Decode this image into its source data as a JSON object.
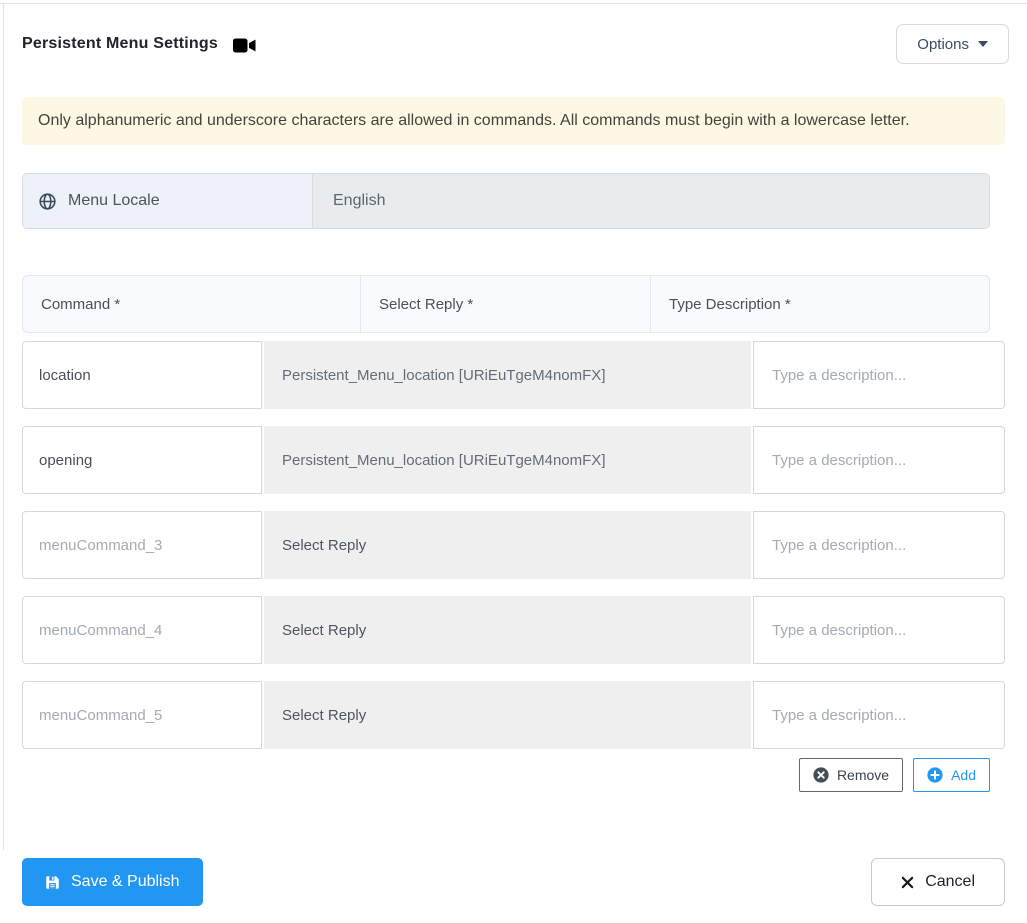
{
  "header": {
    "title": "Persistent Menu Settings",
    "options_label": "Options"
  },
  "alert": {
    "text": "Only alphanumeric and underscore characters are allowed in commands. All commands must begin with a lowercase letter."
  },
  "locale": {
    "label": "Menu Locale",
    "value": "English"
  },
  "table": {
    "headers": [
      "Command *",
      "Select Reply *",
      "Type Description *"
    ],
    "description_placeholder": "Type a description...",
    "rows": [
      {
        "command": "location",
        "command_is_placeholder": false,
        "reply": "Persistent_Menu_location [URiEuTgeM4nomFX]",
        "reply_is_selected": true,
        "description": ""
      },
      {
        "command": "opening",
        "command_is_placeholder": false,
        "reply": "Persistent_Menu_location [URiEuTgeM4nomFX]",
        "reply_is_selected": true,
        "description": ""
      },
      {
        "command": "menuCommand_3",
        "command_is_placeholder": true,
        "reply": "Select Reply",
        "reply_is_selected": false,
        "description": ""
      },
      {
        "command": "menuCommand_4",
        "command_is_placeholder": true,
        "reply": "Select Reply",
        "reply_is_selected": false,
        "description": ""
      },
      {
        "command": "menuCommand_5",
        "command_is_placeholder": true,
        "reply": "Select Reply",
        "reply_is_selected": false,
        "description": ""
      }
    ]
  },
  "actions": {
    "remove_label": "Remove",
    "add_label": "Add"
  },
  "footer": {
    "save_label": "Save & Publish",
    "cancel_label": "Cancel"
  },
  "icons": {
    "title_icon": "video-camera",
    "locale_icon": "globe",
    "options_caret": "caret-down",
    "remove_icon": "circle-x",
    "add_icon": "circle-plus",
    "save_icon": "floppy-disk",
    "cancel_icon": "x"
  },
  "colors": {
    "primary_blue": "#2196f3",
    "alert_bg": "#fcf8e3",
    "locale_label_bg": "#eef1f7",
    "disabled_input_bg": "#e9ecef",
    "grid_header_bg": "#f8fafd",
    "select_bg": "#efefef",
    "text_dark": "#212529",
    "text_muted": "#495057",
    "placeholder": "#a3abb3"
  }
}
